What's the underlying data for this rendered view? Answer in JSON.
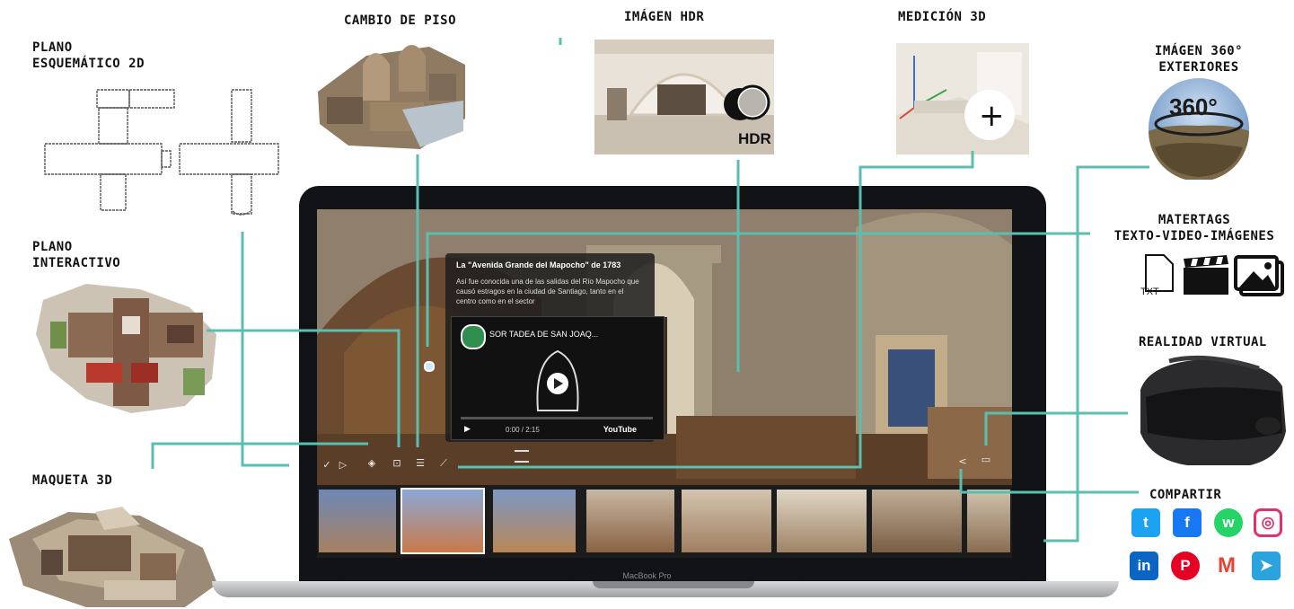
{
  "labels": {
    "plano_2d": [
      "PLANO",
      "ESQUEMÁTICO 2D"
    ],
    "cambio_piso": "CAMBIO DE PISO",
    "imagen_hdr": "IMÁGEN HDR",
    "medicion_3d": "MEDICIÓN 3D",
    "imagen_360": [
      "IMÁGEN 360°",
      "EXTERIORES"
    ],
    "plano_interactivo": [
      "PLANO",
      "INTERACTIVO"
    ],
    "matertags": [
      "MATERTAGS",
      "TEXTO-VIDEO-IMÁGENES"
    ],
    "realidad_virtual": "REALIDAD VIRTUAL",
    "maqueta_3d": "MAQUETA 3D",
    "compartir": "COMPARTIR"
  },
  "badges": {
    "hdr": "HDR",
    "deg360": "360°",
    "txt": "TXT",
    "plus": "+"
  },
  "tag_card": {
    "title": "La \"Avenida Grande del Mapocho\" de 1783",
    "body": "Así fue conocida una de las salidas del Río Mapocho que causó estragos en la ciudad de Santiago, tanto en el centro como en el sector"
  },
  "video": {
    "title": "SOR TADEA DE SAN JOAQ...",
    "brand": "YouTube",
    "time": "0:00 / 2:15"
  },
  "laptop": {
    "brand": "MacBook Pro"
  },
  "social": {
    "twitter": "t",
    "facebook": "f",
    "whatsapp": "w",
    "instagram": "◎",
    "linkedin": "in",
    "pinterest": "P",
    "gmail": "M",
    "telegram": "➤"
  },
  "colors": {
    "connector": "#5bbfb0",
    "twitter": "#1da1f2",
    "facebook": "#1877f2",
    "whatsapp": "#25d366",
    "instagram": "#e1306c",
    "linkedin": "#0a66c2",
    "pinterest": "#e60023",
    "gmail": "#ea4335",
    "telegram": "#2aa3df"
  }
}
